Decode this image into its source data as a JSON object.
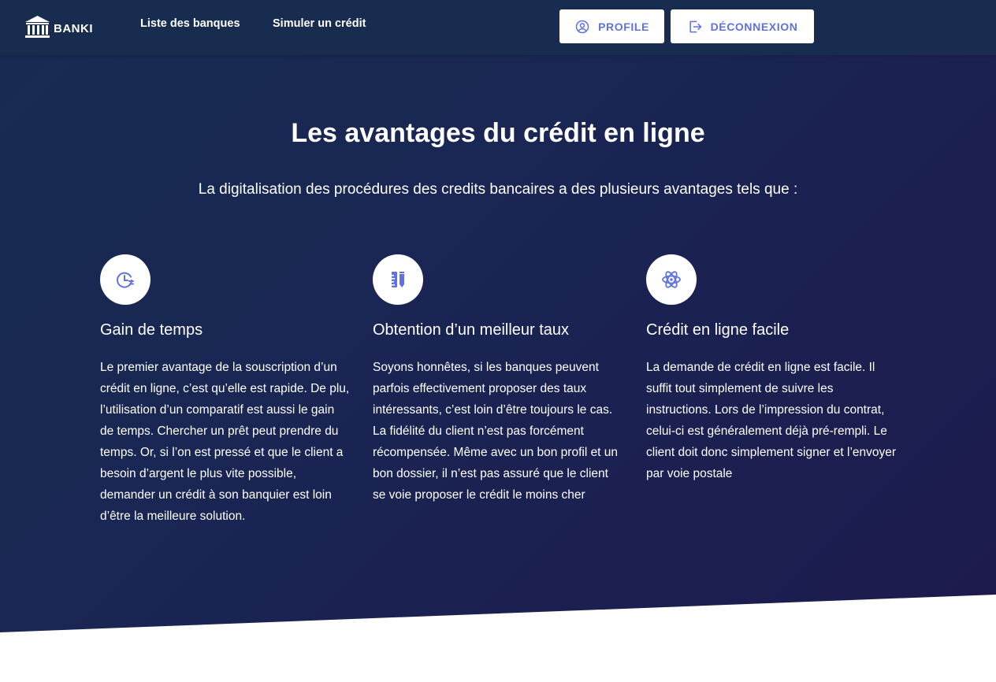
{
  "navbar": {
    "brand": "BANKI",
    "links": [
      {
        "label": "Liste des banques"
      },
      {
        "label": "Simuler un crédit"
      }
    ],
    "profile_label": "PROFILE",
    "logout_label": "DÉCONNEXION"
  },
  "hero": {
    "title": "Les avantages du crédit en ligne",
    "subtitle": "La digitalisation des procédures des credits bancaires a des plusieurs avantages tels que :"
  },
  "features": [
    {
      "icon": "clock-icon",
      "title": "Gain de temps",
      "text": "Le premier avantage de la souscription d’un crédit en ligne, c’est qu’elle est rapide. De plu, l’utilisation d’un comparatif est aussi le gain de temps. Chercher un prêt peut prendre du temps. Or, si l’on est pressé et que le client a besoin d’argent le plus vite possible, demander un crédit à son banquier est loin d’être la meilleure solution."
    },
    {
      "icon": "ruler-pencil-icon",
      "title": "Obtention d’un meilleur taux",
      "text": "Soyons honnêtes, si les banques peuvent parfois effectivement proposer des taux intéressants, c’est loin d’être toujours le cas. La fidélité du client n’est pas forcément récompensée. Même avec un bon profil et un bon dossier, il n’est pas assuré que le client se voie proposer le crédit le moins cher"
    },
    {
      "icon": "atom-icon",
      "title": "Crédit en ligne facile",
      "text": "La demande de crédit en ligne est facile. Il suffit tout simplement de suivre les instructions. Lors de l’impression du contrat, celui-ci est généralement déjà pré-rempli. Le client doit donc simplement signer et l’envoyer par voie postale"
    }
  ],
  "colors": {
    "navbar": "#172c4e",
    "hero_start": "#172c52",
    "hero_end": "#1d1a4e",
    "accent": "#5e72e4"
  }
}
